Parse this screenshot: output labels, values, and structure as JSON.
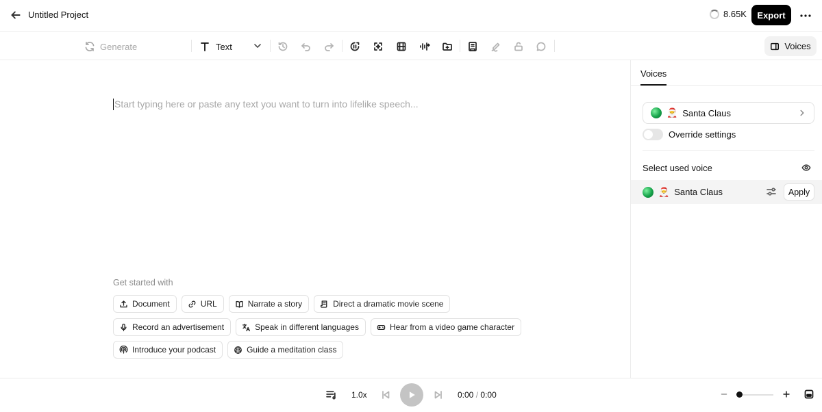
{
  "header": {
    "project_title": "Untitled Project",
    "credits": "8.65K",
    "export_label": "Export"
  },
  "toolbar": {
    "generate_label": "Generate",
    "mode_label": "Text",
    "voices_label": "Voices"
  },
  "editor": {
    "placeholder": "Start typing here or paste any text you want to turn into lifelike speech...",
    "get_started_label": "Get started with",
    "chips": [
      [
        "Document",
        "URL",
        "Narrate a story",
        "Direct a dramatic movie scene"
      ],
      [
        "Record an advertisement",
        "Speak in different languages",
        "Hear from a video game character"
      ],
      [
        "Introduce your podcast",
        "Guide a meditation class"
      ]
    ]
  },
  "panel": {
    "tab_label": "Voices",
    "selected_voice": {
      "emoji": "🎅",
      "name": "Santa Claus"
    },
    "override_label": "Override settings",
    "select_used_voice_label": "Select used voice",
    "used_voice": {
      "emoji": "🎅",
      "name": "Santa Claus"
    },
    "apply_label": "Apply"
  },
  "player": {
    "speed": "1.0x",
    "current_time": "0:00",
    "separator": "/",
    "total_time": "0:00"
  },
  "colors": {
    "export_bg": "#000000",
    "voices_btn_bg": "#f2f2f2",
    "play_bg": "#c4c4c4",
    "voice_row_bg": "#f4f4f4"
  }
}
